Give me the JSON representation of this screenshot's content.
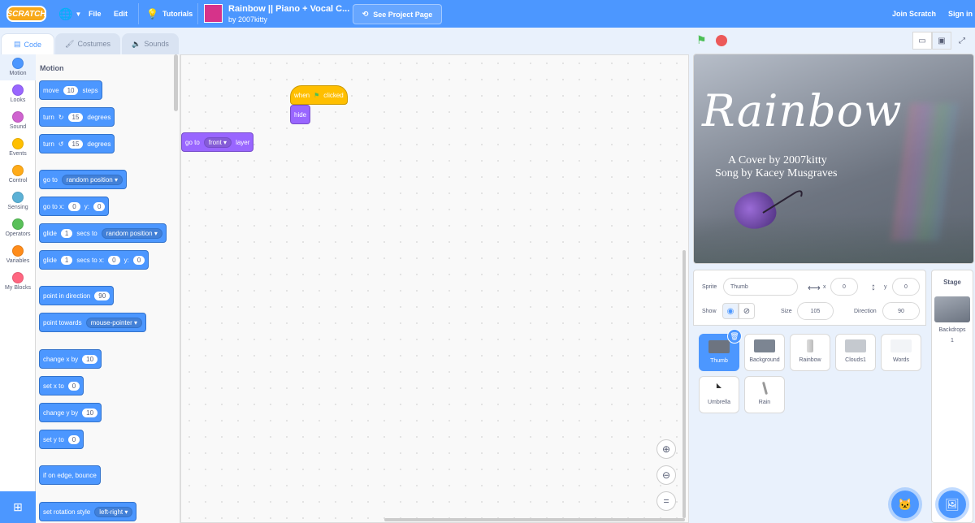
{
  "menubar": {
    "logo": "SCRATCH",
    "file": "File",
    "edit": "Edit",
    "tutorials": "Tutorials",
    "project_title": "Rainbow || Piano + Vocal C...",
    "project_author": "by 2007kitty",
    "see_project_page": "See Project Page",
    "join": "Join Scratch",
    "signin": "Sign in"
  },
  "tabs": {
    "code": "Code",
    "costumes": "Costumes",
    "sounds": "Sounds"
  },
  "categories": [
    {
      "label": "Motion",
      "color": "#4c97ff"
    },
    {
      "label": "Looks",
      "color": "#9966ff"
    },
    {
      "label": "Sound",
      "color": "#cf63cf"
    },
    {
      "label": "Events",
      "color": "#ffbf00"
    },
    {
      "label": "Control",
      "color": "#ffab19"
    },
    {
      "label": "Sensing",
      "color": "#5cb1d6"
    },
    {
      "label": "Operators",
      "color": "#59c059"
    },
    {
      "label": "Variables",
      "color": "#ff8c1a"
    },
    {
      "label": "My Blocks",
      "color": "#ff6680"
    }
  ],
  "palette": {
    "heading": "Motion",
    "move": {
      "a": "move",
      "v": "10",
      "b": "steps"
    },
    "turn_cw": {
      "a": "turn",
      "v": "15",
      "b": "degrees"
    },
    "turn_ccw": {
      "a": "turn",
      "v": "15",
      "b": "degrees"
    },
    "goto": {
      "a": "go to",
      "d": "random position"
    },
    "gotoxy": {
      "a": "go to x:",
      "x": "0",
      "ylab": "y:",
      "y": "0"
    },
    "glide1": {
      "a": "glide",
      "v": "1",
      "b": "secs to",
      "d": "random position"
    },
    "glide2": {
      "a": "glide",
      "v": "1",
      "b": "secs to x:",
      "x": "0",
      "ylab": "y:",
      "y": "0"
    },
    "point_dir": {
      "a": "point in direction",
      "v": "90"
    },
    "point_towards": {
      "a": "point towards",
      "d": "mouse-pointer"
    },
    "change_x": {
      "a": "change x by",
      "v": "10"
    },
    "set_x": {
      "a": "set x to",
      "v": "0"
    },
    "change_y": {
      "a": "change y by",
      "v": "10"
    },
    "set_y": {
      "a": "set y to",
      "v": "0"
    },
    "bounce": {
      "a": "if on edge, bounce"
    },
    "rotation": {
      "a": "set rotation style",
      "d": "left-right"
    }
  },
  "script": {
    "when": "when",
    "clicked": "clicked",
    "hide": "hide",
    "goto_a": "go to",
    "goto_d": "front",
    "goto_b": "layer"
  },
  "stage": {
    "title": "Rainbow",
    "line1": "A Cover by 2007kitty",
    "line2": "Song by Kacey Musgraves"
  },
  "sprite_info": {
    "sprite_label": "Sprite",
    "sprite_name": "Thumb",
    "x_label": "x",
    "x": "0",
    "y_label": "y",
    "y": "0",
    "show_label": "Show",
    "size_label": "Size",
    "size": "105",
    "direction_label": "Direction",
    "direction": "90"
  },
  "sprites": [
    {
      "name": "Thumb"
    },
    {
      "name": "Background"
    },
    {
      "name": "Rainbow"
    },
    {
      "name": "Clouds1"
    },
    {
      "name": "Words"
    },
    {
      "name": "Umbrella"
    },
    {
      "name": "Rain"
    }
  ],
  "stage_pane": {
    "title": "Stage",
    "backdrops_label": "Backdrops",
    "backdrops_count": "1"
  }
}
